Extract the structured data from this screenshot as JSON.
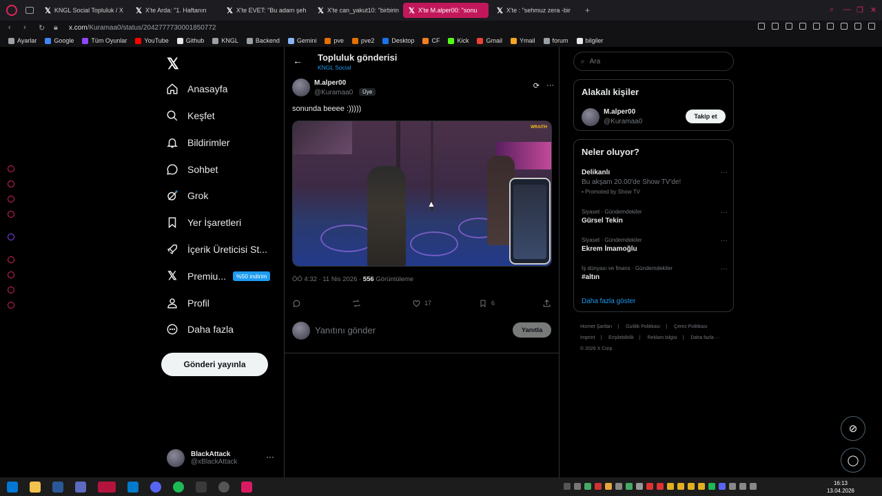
{
  "browser": {
    "tabs": [
      {
        "label": "KNGL Social Topluluk / X",
        "active": false
      },
      {
        "label": "X'te Arda: \"1. Haftanın",
        "active": false
      },
      {
        "label": "X'te EVET: \"Bu adam şeh",
        "active": false
      },
      {
        "label": "X'te can_yakut10: \"birbirin",
        "active": false
      },
      {
        "label": "X'te M.alper00: \"sonu",
        "active": true
      },
      {
        "label": "X'te : \"sehmuz zera -bir",
        "active": false
      }
    ],
    "url_host": "x.com",
    "url_path": "/Kuramaa0/status/2042777730001850772",
    "bookmarks": [
      {
        "label": "Ayarlar",
        "color": "#9aa0a6"
      },
      {
        "label": "Google",
        "color": "#4285f4"
      },
      {
        "label": "Tüm Oyunlar",
        "color": "#9146ff"
      },
      {
        "label": "YouTube",
        "color": "#ff0000"
      },
      {
        "label": "Github",
        "color": "#e8e8e8"
      },
      {
        "label": "KNGL",
        "color": "#9aa0a6"
      },
      {
        "label": "Backend",
        "color": "#9aa0a6"
      },
      {
        "label": "Gemini",
        "color": "#8ab4f8"
      },
      {
        "label": "pve",
        "color": "#e57000"
      },
      {
        "label": "pve2",
        "color": "#e57000"
      },
      {
        "label": "Desktop",
        "color": "#1a73e8"
      },
      {
        "label": "CF",
        "color": "#f38020"
      },
      {
        "label": "Kick",
        "color": "#53fc18"
      },
      {
        "label": "Gmail",
        "color": "#ea4335"
      },
      {
        "label": "Ymail",
        "color": "#f6a623"
      },
      {
        "label": "forum",
        "color": "#9aa0a6"
      },
      {
        "label": "bilgiler",
        "color": "#e8e8e8"
      }
    ]
  },
  "nav": {
    "items": [
      {
        "label": "Anasayfa",
        "icon": "home-icon"
      },
      {
        "label": "Keşfet",
        "icon": "search-icon"
      },
      {
        "label": "Bildirimler",
        "icon": "bell-icon"
      },
      {
        "label": "Sohbet",
        "icon": "chat-icon"
      },
      {
        "label": "Grok",
        "icon": "grok-icon"
      },
      {
        "label": "Yer İşaretleri",
        "icon": "bookmark-icon"
      },
      {
        "label": "İçerik Üreticisi St...",
        "icon": "rocket-icon"
      },
      {
        "label": "Premiu...",
        "icon": "x-icon"
      },
      {
        "label": "Profil",
        "icon": "person-icon"
      },
      {
        "label": "Daha fazla",
        "icon": "more-circle-icon"
      }
    ],
    "premium_badge": "%50 indirim",
    "post_button": "Gönderi yayınla",
    "account": {
      "name": "BlackAttack",
      "handle": "@xBlackAttack"
    }
  },
  "main": {
    "title": "Topluluk gönderisi",
    "subtitle": "KNGL Social",
    "author": {
      "name": "M.alper00",
      "handle": "@Kuramaa0",
      "badge": "Üye"
    },
    "text": "sonunda beeee :)))))",
    "media_watermark": "WRAITH",
    "meta": {
      "time": "ÖÖ 4:32 · 11 Nis 2026 · ",
      "views": "556",
      "views_label": " Görüntüleme"
    },
    "actions": {
      "replies": "",
      "reposts": "",
      "likes": "17",
      "bookmarks": "6"
    },
    "reply_placeholder": "Yanıtını gönder",
    "reply_button": "Yanıtla"
  },
  "right": {
    "search_placeholder": "Ara",
    "related_title": "Alakalı kişiler",
    "related": {
      "name": "M.alper00",
      "handle": "@Kuramaa0",
      "follow": "Takip et"
    },
    "trends_title": "Neler oluyor?",
    "trends": [
      {
        "name": "Delikanlı",
        "desc": "Bu akşam 20.00'de Show TV'de!",
        "promo": "Promoted by Show TV"
      },
      {
        "category": "Siyaset · Gündemdekiler",
        "name": "Gürsel Tekin"
      },
      {
        "category": "Siyaset · Gündemdekiler",
        "name": "Ekrem İmamoğlu"
      },
      {
        "category": "İş dünyası ve finans · Gündemdekiler",
        "name": "#altın"
      }
    ],
    "show_more": "Daha fazla göster",
    "footer": [
      "Hizmet Şartları",
      "Gizlilik Politikası",
      "Çerez Politikası",
      "Imprint",
      "Erişilebilirlik",
      "Reklam bilgisi",
      "Daha fazla ···",
      "© 2026 X Corp."
    ]
  },
  "taskbar": {
    "time": "16:13",
    "date": "13.04.2026"
  }
}
